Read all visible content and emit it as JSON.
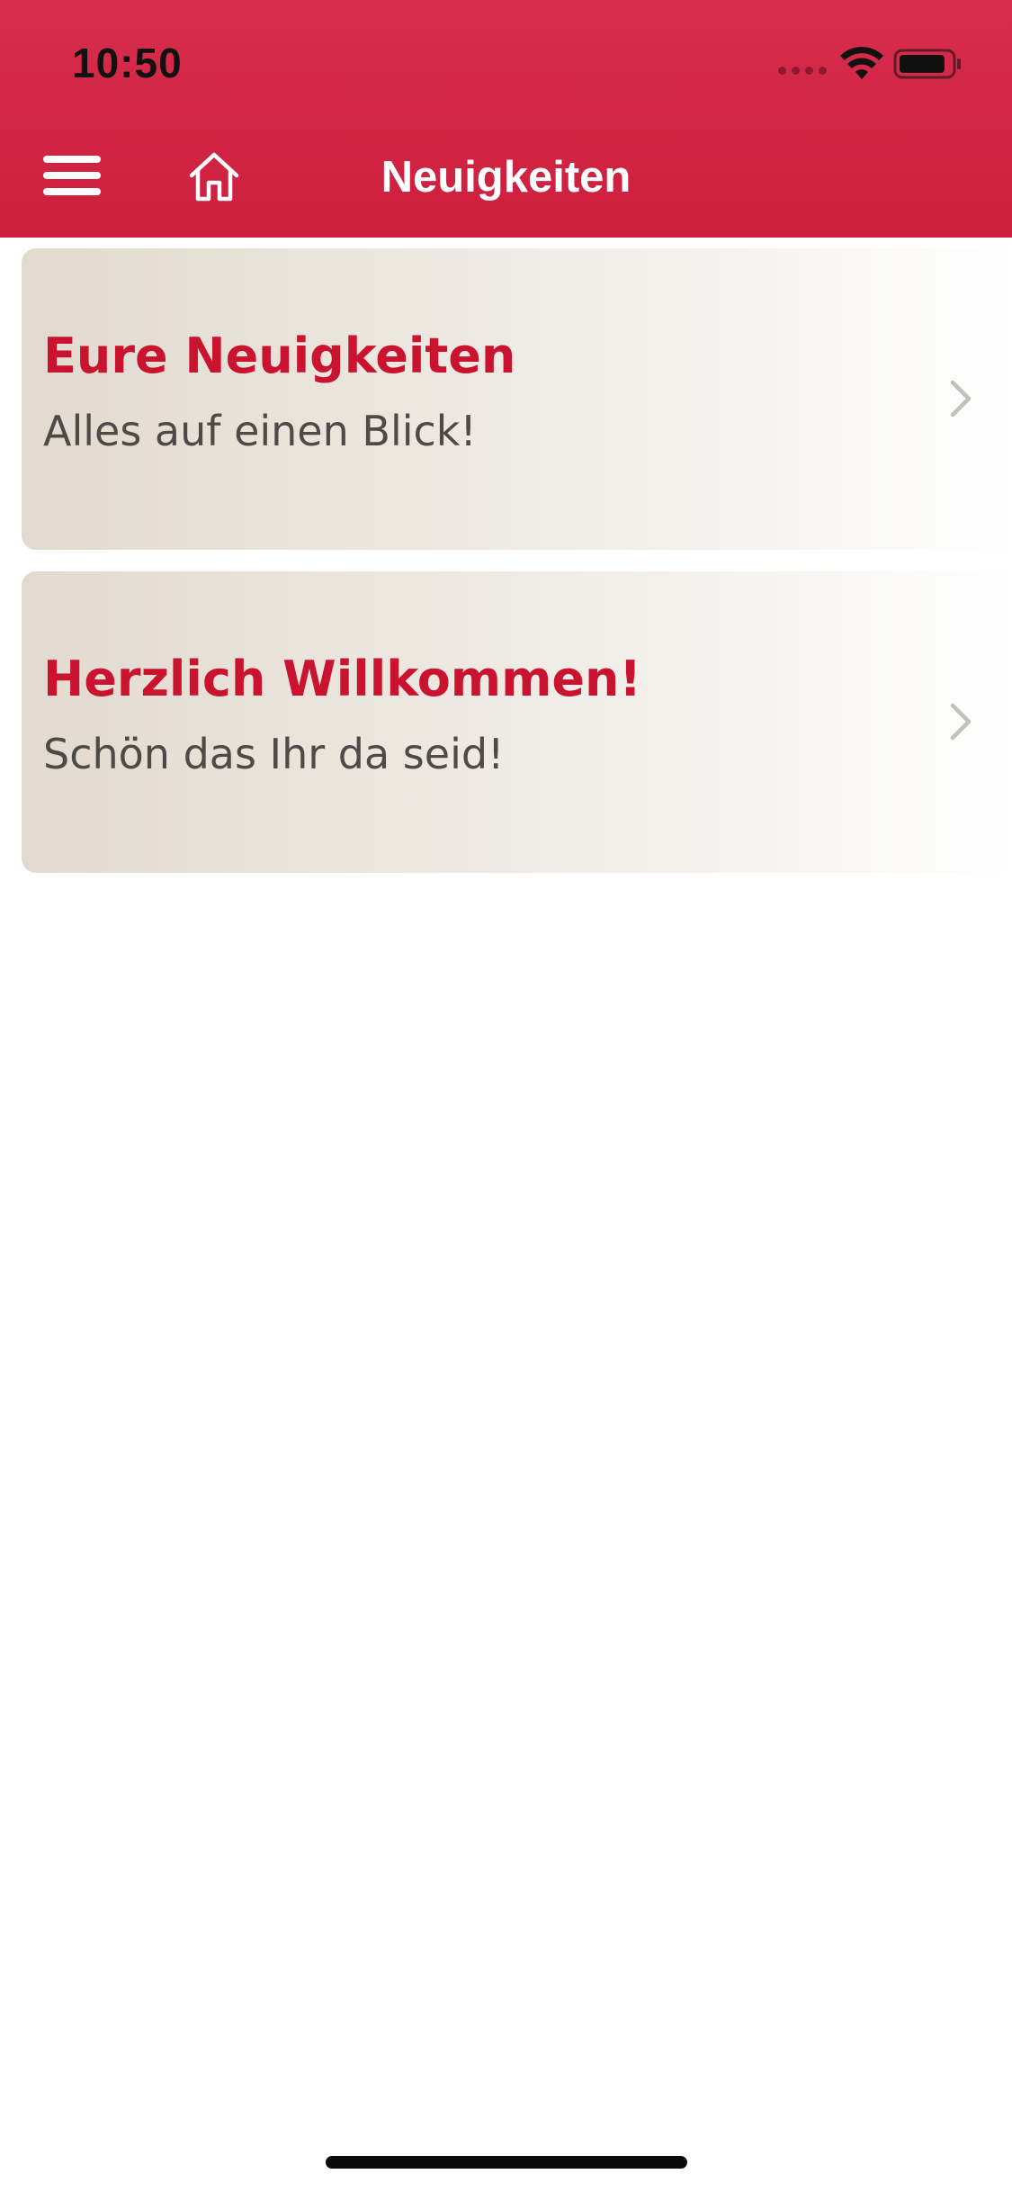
{
  "status_bar": {
    "time": "10:50"
  },
  "nav": {
    "title": "Neuigkeiten",
    "menu_icon": "hamburger-menu-icon",
    "home_icon": "home-icon"
  },
  "cards": [
    {
      "title": "Eure Neuigkeiten",
      "subtitle": "Alles auf einen Blick!"
    },
    {
      "title": "Herzlich Willkommen!",
      "subtitle": "Schön das Ihr da seid!"
    }
  ],
  "colors": {
    "header": "#cc1f3d",
    "title_red": "#c9132f",
    "subtitle_gray": "#4d4a47"
  }
}
